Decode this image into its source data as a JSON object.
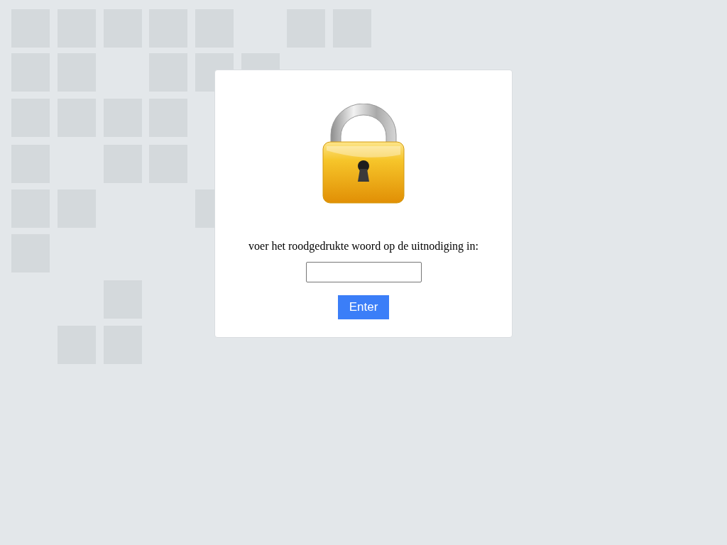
{
  "dialog": {
    "prompt": "voer het roodgedrukte woord op de uitnodiging in:",
    "button": "Enter"
  }
}
